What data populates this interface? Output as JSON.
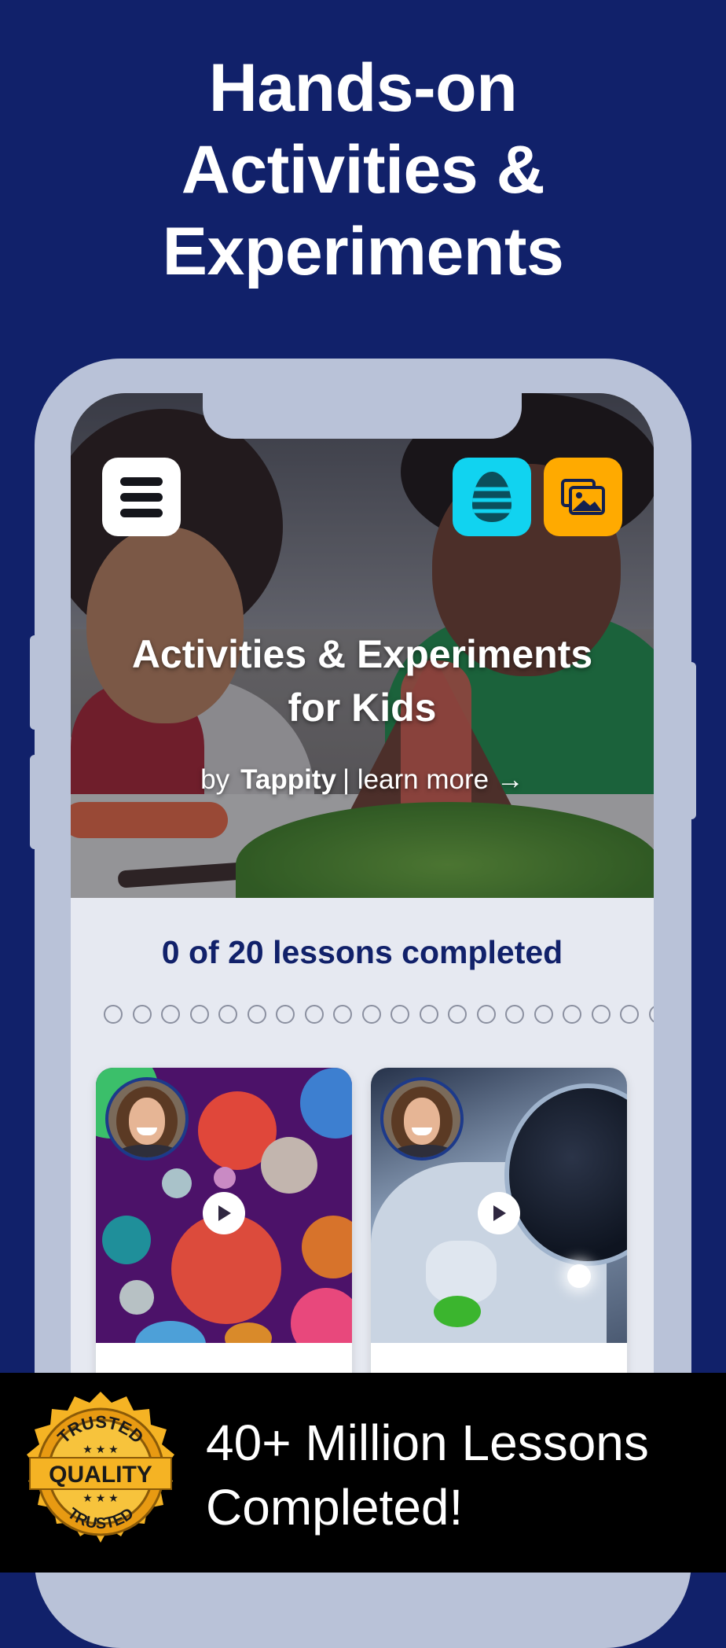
{
  "headline": {
    "line1": "Hands-on",
    "line2": "Activities &",
    "line3": "Experiments"
  },
  "app": {
    "hero": {
      "title_line1": "Activities & Experiments",
      "title_line2": "for Kids",
      "by": "by",
      "brand": "Tappity",
      "learn_more": "| learn more →"
    },
    "header": {
      "menu_icon": "hamburger-menu-icon",
      "egg_icon": "egg-icon",
      "gallery_icon": "gallery-icon"
    },
    "progress": {
      "label": "0 of 20 lessons completed",
      "completed": 0,
      "total": 20
    },
    "lessons": [
      {
        "image": "planets",
        "play_icon": "play-icon",
        "title": ""
      },
      {
        "image": "astronaut",
        "play_icon": "play-icon",
        "title": ""
      }
    ]
  },
  "banner": {
    "badge": {
      "top_text": "TRUSTED",
      "middle_text": "QUALITY",
      "bottom_text": "TRUSTED"
    },
    "line1": "40+ Million Lessons",
    "line2": "Completed!"
  },
  "colors": {
    "background": "#11216a",
    "menu_button": "#ffffff",
    "egg_button": "#11d3f0",
    "gallery_button": "#ffaa00",
    "progress_text": "#11216a",
    "banner_background": "#000000",
    "badge_gold": "#f5b324"
  }
}
